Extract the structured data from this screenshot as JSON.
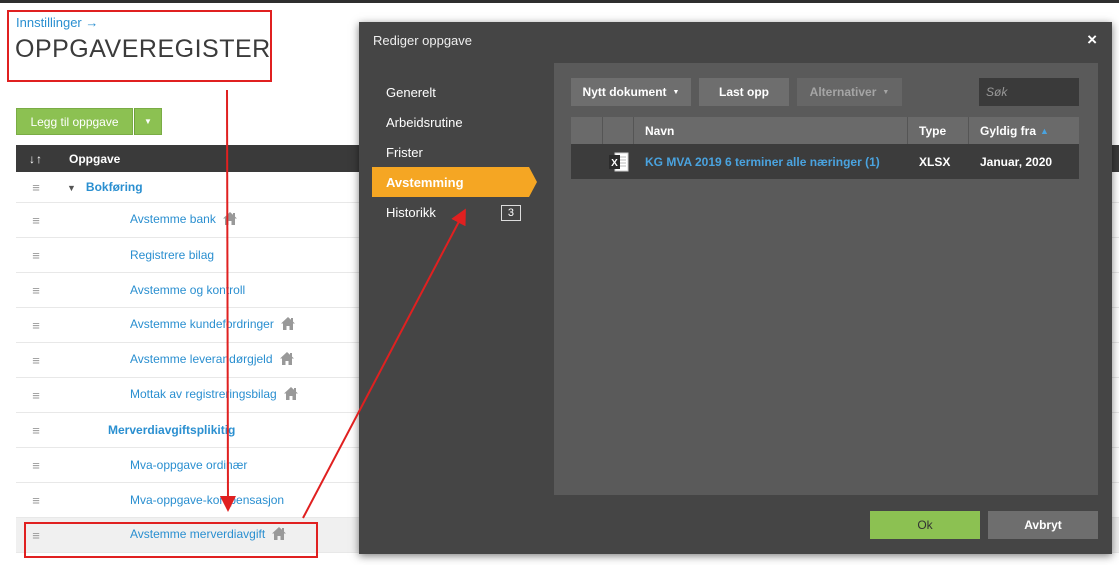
{
  "breadcrumb": {
    "label": "Innstillinger →"
  },
  "page": {
    "title": "OPPGAVEREGISTER"
  },
  "actions": {
    "add_task_label": "Legg til oppgave"
  },
  "table": {
    "sort_header": "↓↑",
    "name_header": "Oppgave",
    "rows": [
      {
        "label": "Bokføring",
        "bold": true,
        "group": true,
        "house": false
      },
      {
        "label": "Avstemme bank",
        "house": true
      },
      {
        "label": "Registrere bilag",
        "house": false
      },
      {
        "label": "Avstemme og kontroll",
        "house": false
      },
      {
        "label": "Avstemme kundefordringer",
        "house": true
      },
      {
        "label": "Avstemme leverandørgjeld",
        "house": true
      },
      {
        "label": "Mottak av registreringsbilag",
        "house": true
      },
      {
        "label": "Merverdiavgiftsplikitig",
        "bold": true,
        "house": false
      },
      {
        "label": "Mva-oppgave ordinær",
        "house": false
      },
      {
        "label": "Mva-oppgave-kompensasjon",
        "house": false
      },
      {
        "label": "Avstemme merverdiavgift",
        "house": true
      }
    ]
  },
  "modal": {
    "title": "Rediger oppgave",
    "close_icon": "×",
    "nav": [
      {
        "label": "Generelt"
      },
      {
        "label": "Arbeidsrutine"
      },
      {
        "label": "Frister"
      },
      {
        "label": "Avstemming",
        "active": true
      },
      {
        "label": "Historikk",
        "badge": "3"
      }
    ],
    "toolbar": {
      "new_document": "Nytt dokument",
      "upload": "Last opp",
      "alternatives": "Alternativer",
      "search_placeholder": "Søk"
    },
    "documents": {
      "headers": {
        "name": "Navn",
        "type": "Type",
        "valid_from": "Gyldig fra",
        "sort_indicator": "▲"
      },
      "rows": [
        {
          "name": "KG MVA 2019 6 terminer alle næringer (1)",
          "type": "XLSX",
          "valid_from": "Januar, 2020",
          "icon": "excel-file-icon"
        }
      ]
    },
    "ok_label": "Ok",
    "cancel_label": "Avbryt"
  },
  "colors": {
    "accent_blue": "#2a8fd0",
    "green": "#8cc152",
    "active_orange": "#f5a623",
    "annotation_red": "#e02020"
  }
}
